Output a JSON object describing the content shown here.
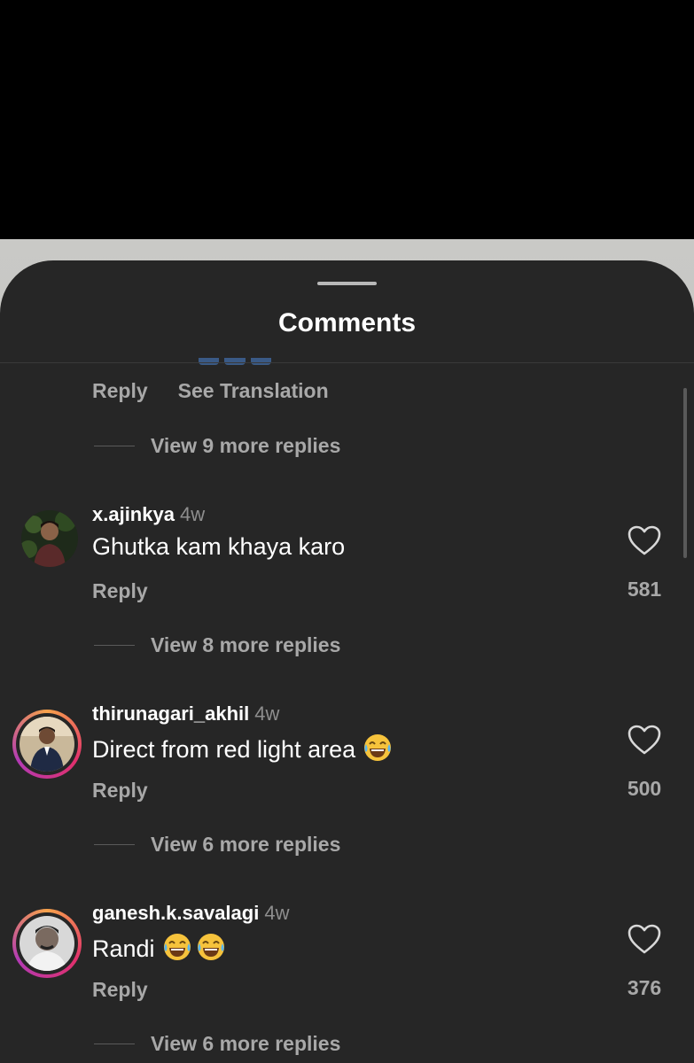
{
  "sheet": {
    "title": "Comments"
  },
  "top": {
    "reply_label": "Reply",
    "translate_label": "See Translation",
    "view_replies": "View 9 more replies"
  },
  "comments": [
    {
      "username": "x.ajinkya",
      "time": "4w",
      "text": "Ghutka kam khaya karo",
      "emojis": [],
      "reply_label": "Reply",
      "likes": "581",
      "view_replies": "View 8 more replies",
      "story_ring": false
    },
    {
      "username": "thirunagari_akhil",
      "time": "4w",
      "text": "Direct from red light area",
      "emojis": [
        "face-with-tears-of-joy"
      ],
      "reply_label": "Reply",
      "likes": "500",
      "view_replies": "View 6 more replies",
      "story_ring": true
    },
    {
      "username": "ganesh.k.savalagi",
      "time": "4w",
      "text": "Randi",
      "emojis": [
        "face-with-tears-of-joy",
        "face-with-tears-of-joy"
      ],
      "reply_label": "Reply",
      "likes": "376",
      "view_replies": "View 6 more replies",
      "story_ring": true
    }
  ],
  "icons": {
    "like": "heart-outline-icon",
    "laugh": "face-with-tears-of-joy"
  },
  "colors": {
    "sheet_bg": "#262626",
    "secondary_text": "#a8a8a8",
    "story_ring_start": "#f7a24b",
    "story_ring_end": "#b23ab4"
  }
}
